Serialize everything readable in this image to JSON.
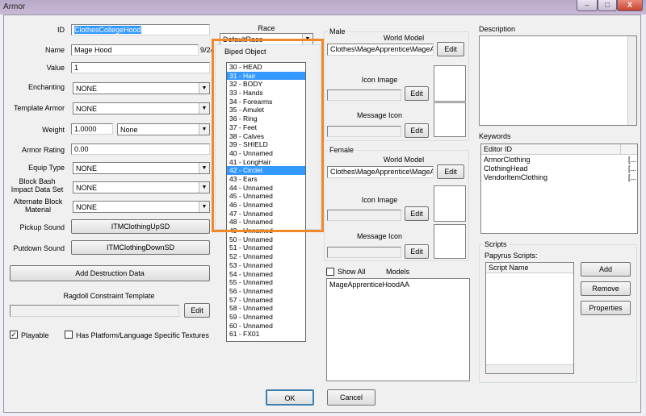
{
  "window": {
    "title": "Armor",
    "btn_minimize": "–",
    "btn_maximize": "□",
    "btn_close": "X"
  },
  "form": {
    "id_label": "ID",
    "id_value": "ClothesCollegeHood",
    "name_label": "Name",
    "name_value": "Mage Hood",
    "name_suffix": "9/24",
    "value_label": "Value",
    "value_value": "1",
    "enchanting_label": "Enchanting",
    "enchanting_value": "NONE",
    "template_label": "Template Armor",
    "template_value": "NONE",
    "weight_label": "Weight",
    "weight_value": "1.0000",
    "weight_type": "None",
    "armor_rating_label": "Armor Rating",
    "armor_rating_value": "0.00",
    "equip_type_label": "Equip Type",
    "equip_type_value": "NONE",
    "block_bash_label": "Block Bash Impact Data Set",
    "block_bash_value": "NONE",
    "alt_block_label": "Alternate Block Material",
    "alt_block_value": "NONE",
    "pickup_label": "Pickup Sound",
    "pickup_value": "ITMClothingUpSD",
    "putdown_label": "Putdown Sound",
    "putdown_value": "ITMClothingDownSD",
    "add_destruction": "Add Destruction Data",
    "ragdoll_label": "Ragdoll Constraint Template",
    "ragdoll_edit": "Edit",
    "playable_label": "Playable",
    "playable_checked": "✓",
    "platform_label": "Has Platform/Language Specific Textures"
  },
  "race": {
    "label": "Race",
    "value": "DefaultRace"
  },
  "biped": {
    "label": "Biped Object",
    "items": [
      "30 - HEAD",
      "31 - Hair",
      "32 - BODY",
      "33 - Hands",
      "34 - Forearms",
      "35 - Amulet",
      "36 - Ring",
      "37 - Feet",
      "38 - Calves",
      "39 - SHIELD",
      "40 - Unnamed",
      "41 - LongHair",
      "42 - Circlet",
      "43 - Ears",
      "44 - Unnamed",
      "45 - Unnamed",
      "46 - Unnamed",
      "47 - Unnamed",
      "48 - Unnamed",
      "49 - Unnamed",
      "50 - Unnamed",
      "51 - Unnamed",
      "52 - Unnamed",
      "53 - Unnamed",
      "54 - Unnamed",
      "55 - Unnamed",
      "56 - Unnamed",
      "57 - Unnamed",
      "58 - Unnamed",
      "59 - Unnamed",
      "60 - Unnamed",
      "61 - FX01"
    ],
    "selected": [
      "31 - Hair",
      "42 - Circlet"
    ]
  },
  "male": {
    "label": "Male",
    "world_model": "World Model",
    "path": "Clothes\\MageApprentice\\MageA",
    "edit": "Edit",
    "icon_image": "Icon Image",
    "icon_edit": "Edit",
    "message_icon": "Message Icon",
    "message_edit": "Edit"
  },
  "female": {
    "label": "Female",
    "world_model": "World Model",
    "path": "Clothes\\MageApprentice\\MageA",
    "edit": "Edit",
    "icon_image": "Icon Image",
    "icon_edit": "Edit",
    "message_icon": "Message Icon",
    "message_edit": "Edit"
  },
  "models": {
    "show_all": "Show All",
    "label": "Models",
    "items": [
      "MageApprenticeHoodAA"
    ]
  },
  "description": {
    "label": "Description"
  },
  "keywords": {
    "label": "Keywords",
    "col1": "Editor ID",
    "items": [
      "ArmorClothing",
      "ClothingHead",
      "VendorItemClothing"
    ],
    "col2": "[..."
  },
  "scripts": {
    "label": "Scripts",
    "papyrus": "Papyrus Scripts:",
    "col": "Script Name",
    "add": "Add",
    "remove": "Remove",
    "properties": "Properties"
  },
  "footer": {
    "ok": "OK",
    "cancel": "Cancel"
  }
}
